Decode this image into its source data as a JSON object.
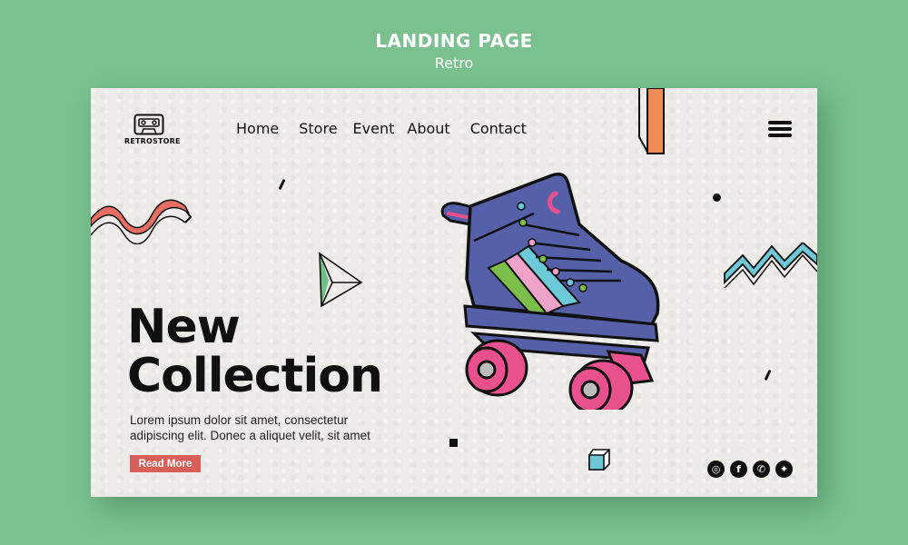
{
  "header": {
    "title": "LANDING PAGE",
    "subtitle": "Retro"
  },
  "brand": {
    "logo_icon": "cassette-tape-icon",
    "name": "RETROSTORE"
  },
  "nav": {
    "items": [
      {
        "label": "Home"
      },
      {
        "label": "Store"
      },
      {
        "label": "Event"
      },
      {
        "label": "About"
      },
      {
        "label": "Contact"
      }
    ],
    "menu_icon": "hamburger-menu-icon"
  },
  "hero": {
    "headline_line1": "New",
    "headline_line2": "Collection",
    "body": "Lorem ipsum dolor sit amet, consectetur adipiscing elit. Donec a aliquet velit, sit amet",
    "cta_label": "Read More",
    "illustration": "roller-skate"
  },
  "socials": [
    {
      "name": "instagram-icon",
      "glyph": "◎"
    },
    {
      "name": "facebook-icon",
      "glyph": "f"
    },
    {
      "name": "whatsapp-icon",
      "glyph": "✆"
    },
    {
      "name": "twitter-icon",
      "glyph": "✦"
    }
  ],
  "colors": {
    "background": "#7bc08f",
    "card": "#ecebe8",
    "accent_red": "#d85f57",
    "skate_blue": "#5560a8",
    "wheel_pink": "#e8508e",
    "stripe_cyan": "#6cc9d8",
    "stripe_green": "#7bbf4a",
    "stripe_pink": "#f0a3c8",
    "deco_orange": "#ef8d55",
    "deco_teal": "#6fc6d4",
    "deco_green": "#6fbf85"
  }
}
